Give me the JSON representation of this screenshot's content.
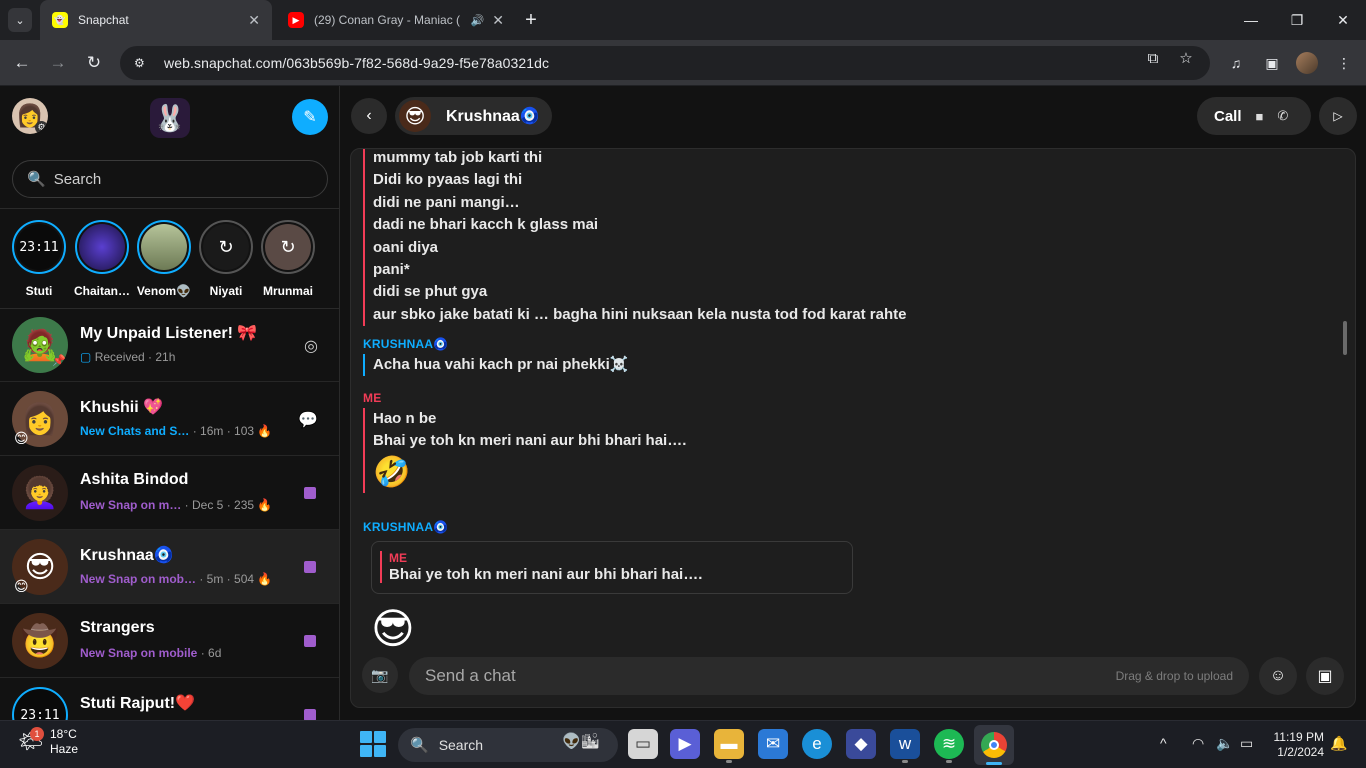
{
  "browser": {
    "tabs": [
      {
        "title": "Snapchat",
        "active": true,
        "favicon": "snapchat-icon"
      },
      {
        "title": "(29) Conan Gray - Maniac (",
        "active": false,
        "favicon": "youtube-icon",
        "audio": true
      }
    ],
    "url": "web.snapchat.com/063b569b-7f82-568d-9a29-f5e78a0321dc"
  },
  "sidebar": {
    "search_placeholder": "Search",
    "stories": [
      {
        "name": "Stuti",
        "thumb": "23:11",
        "seen": false
      },
      {
        "name": "Chaitan…",
        "thumb": "",
        "seen": false
      },
      {
        "name": "Venom👽",
        "thumb": "",
        "seen": false
      },
      {
        "name": "Niyati",
        "thumb": "",
        "seen": true
      },
      {
        "name": "Mrunmai",
        "thumb": "",
        "seen": true
      }
    ],
    "chats": [
      {
        "name": "My Unpaid Listener! 🎀",
        "status": "Received",
        "meta": " · 21h",
        "status_color": "grey",
        "right": "camera-icon",
        "avatar": "🧟"
      },
      {
        "name": "Khushii 💖",
        "status": "New Chats and S…",
        "meta": " · 16m · 103 🔥",
        "status_color": "blue",
        "right": "chat-bubbles-icon",
        "avatar": "👩"
      },
      {
        "name": "Ashita Bindod",
        "status": "New Snap on m…",
        "meta": " · Dec 5 · 235 🔥",
        "status_color": "purple",
        "right": "snap-square",
        "avatar": "👩‍🦱"
      },
      {
        "name": "Krushnaa🧿",
        "status": "New Snap on mob…",
        "meta": " · 5m · 504 🔥",
        "status_color": "purple",
        "right": "snap-square",
        "avatar": "😎",
        "selected": true
      },
      {
        "name": "Strangers",
        "status": "New Snap on mobile",
        "meta": " · 6d",
        "status_color": "purple",
        "right": "snap-square",
        "avatar": "🤠"
      },
      {
        "name": "Stuti Rajput!❤️",
        "status": "",
        "meta": "",
        "status_color": "purple",
        "right": "snap-square",
        "avatar": "23:11"
      }
    ]
  },
  "conversation": {
    "friend_name": "Krushnaa🧿",
    "call_label": "Call",
    "block1": [
      "mummy tab job karti thi",
      "Didi ko pyaas lagi thi",
      "didi ne pani mangi…",
      "dadi ne bhari kacch k glass mai",
      "oani diya",
      "pani*",
      "didi se phut gya",
      "aur sbko jake batati ki … bagha hini nuksaan kela nusta tod fod karat rahte"
    ],
    "sender_krushnaa": "KRUSHNAA🧿",
    "block2": [
      "Acha hua vahi kach pr nai phekki☠️"
    ],
    "sender_me": "ME",
    "block3": [
      "Hao n be",
      "Bhai ye toh kn meri nani aur bhi bhari hai…."
    ],
    "block3_emoji": "🤣",
    "reply_sender": "ME",
    "reply_text": "Bhai ye toh kn meri nani aur bhi bhari hai….",
    "compose_placeholder": "Send a chat",
    "drag_drop": "Drag & drop to upload"
  },
  "taskbar": {
    "temp": "18°C",
    "condition": "Haze",
    "notif_count": "1",
    "search_label": "Search",
    "time": "11:19 PM",
    "date": "1/2/2024"
  }
}
